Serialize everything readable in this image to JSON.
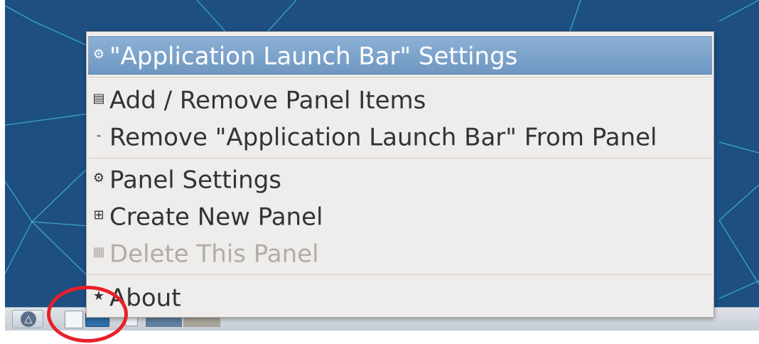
{
  "menu": {
    "items": [
      {
        "icon": "gear-icon",
        "glyph": "⚙",
        "label": "\"Application Launch Bar\" Settings"
      },
      {
        "icon": "list-icon",
        "glyph": "▤",
        "label": "Add / Remove Panel Items"
      },
      {
        "icon": "minus-icon",
        "glyph": "-",
        "label": "Remove \"Application Launch Bar\" From Panel"
      },
      {
        "icon": "gear-icon",
        "glyph": "⚙",
        "label": "Panel Settings"
      },
      {
        "icon": "plus-box-icon",
        "glyph": "⊞",
        "label": "Create New Panel"
      },
      {
        "icon": "trash-icon",
        "glyph": "▦",
        "label": "Delete This Panel"
      },
      {
        "icon": "star-icon",
        "glyph": "★",
        "label": "About"
      }
    ]
  },
  "colors": {
    "desktop": "#1d4f82",
    "highlight": "#7aa2cc",
    "annotation_circle": "#e8202a"
  },
  "panel": {
    "start_icon": "lxqt-logo-icon",
    "start_glyph": "△"
  }
}
